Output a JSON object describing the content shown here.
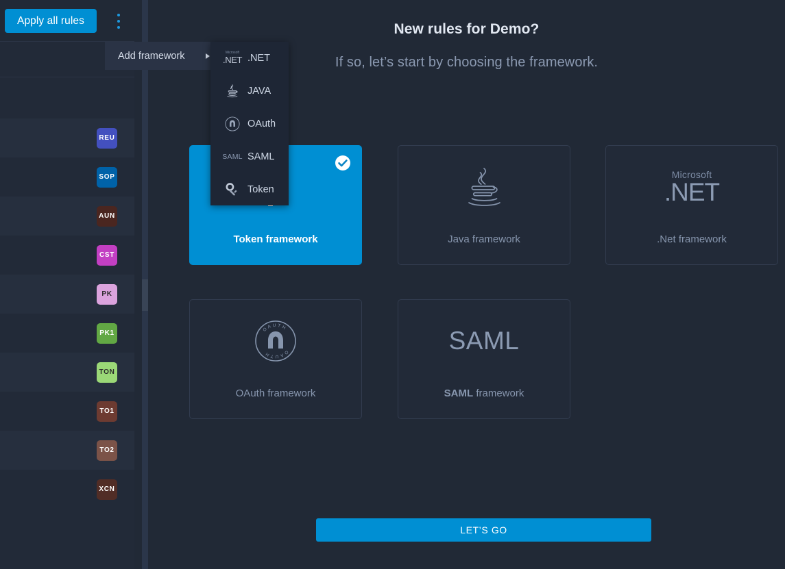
{
  "sidebar": {
    "apply_button_label": "Apply all rules",
    "kebab_icon": "more-vertical-icon",
    "rows": [
      {
        "badge": "REU",
        "color": "#4350bf"
      },
      {
        "badge": "SOP",
        "color": "#0062a8"
      },
      {
        "badge": "AUN",
        "color": "#4a2620"
      },
      {
        "badge": "CST",
        "color": "#c33fc3"
      },
      {
        "badge": "PK",
        "color": "#dba3dd"
      },
      {
        "badge": "PK1",
        "color": "#62a844"
      },
      {
        "badge": "TON",
        "color": "#9bd877"
      },
      {
        "badge": "TO1",
        "color": "#6d3b31"
      },
      {
        "badge": "TO2",
        "color": "#7b5348"
      },
      {
        "badge": "XCN",
        "color": "#512d26"
      }
    ]
  },
  "context_menu": {
    "item_label": "Add framework",
    "arrow_icon": "chevron-right-icon",
    "submenu": [
      {
        "label": ".NET",
        "icon": "dotnet-icon"
      },
      {
        "label": "JAVA",
        "icon": "java-icon"
      },
      {
        "label": "OAuth",
        "icon": "oauth-icon"
      },
      {
        "label": "SAML",
        "icon": "saml-icon"
      },
      {
        "label": "Token",
        "icon": "key-icon"
      }
    ]
  },
  "main": {
    "title": "New rules for Demo?",
    "subtitle": "If so, let’s start by choosing the framework.",
    "cta_label": "LET’S GO",
    "accent_color": "#008fd3",
    "cards": [
      {
        "label": "Token framework",
        "art": "key-icon",
        "selected": true,
        "check_icon": "check-circle-icon"
      },
      {
        "label": "Java framework",
        "art": "java-icon",
        "selected": false
      },
      {
        "label": ".Net framework",
        "art": "dotnet-icon",
        "selected": false,
        "logo_top": "Microsoft",
        "logo_main": ".NET"
      },
      {
        "label": "OAuth framework",
        "art": "oauth-icon",
        "selected": false,
        "logo_ring": "OAUTH"
      },
      {
        "label": "SAML framework",
        "art": "saml-icon",
        "selected": false,
        "logo_main": "SAML"
      }
    ]
  }
}
